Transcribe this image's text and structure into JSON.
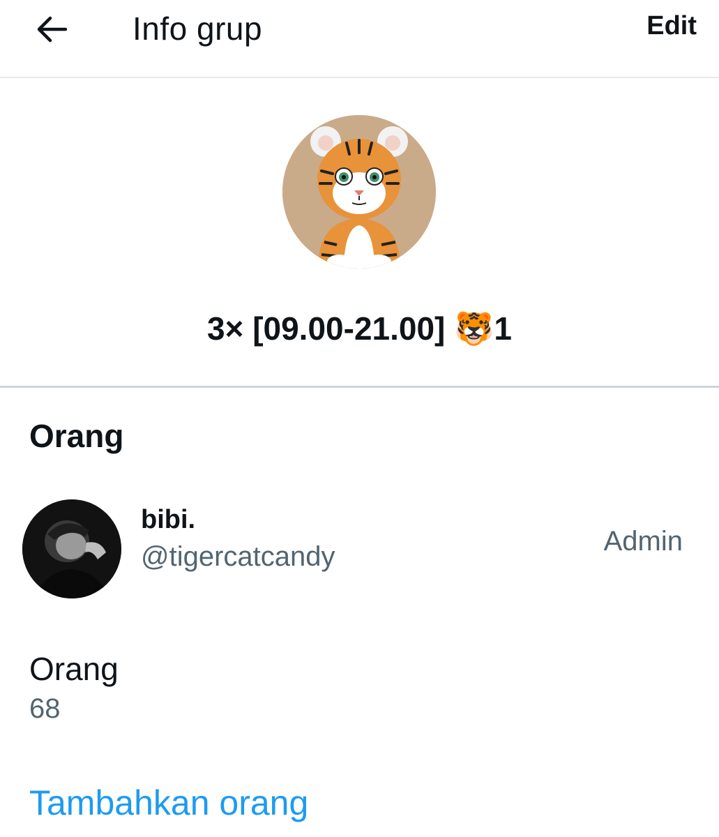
{
  "header": {
    "title": "Info grup",
    "edit_label": "Edit"
  },
  "group": {
    "name": "3× [09.00-21.00] 🐯1"
  },
  "people_section": {
    "title": "Orang",
    "members": [
      {
        "name": "bibi.",
        "handle": "@tigercatcandy",
        "role": "Admin"
      }
    ]
  },
  "people_count": {
    "label": "Orang",
    "value": "68"
  },
  "actions": {
    "add_people_label": "Tambahkan orang"
  },
  "colors": {
    "text_primary": "#0f1419",
    "text_secondary": "#536471",
    "link": "#1d9bf0",
    "divider": "#e6e9ec"
  }
}
